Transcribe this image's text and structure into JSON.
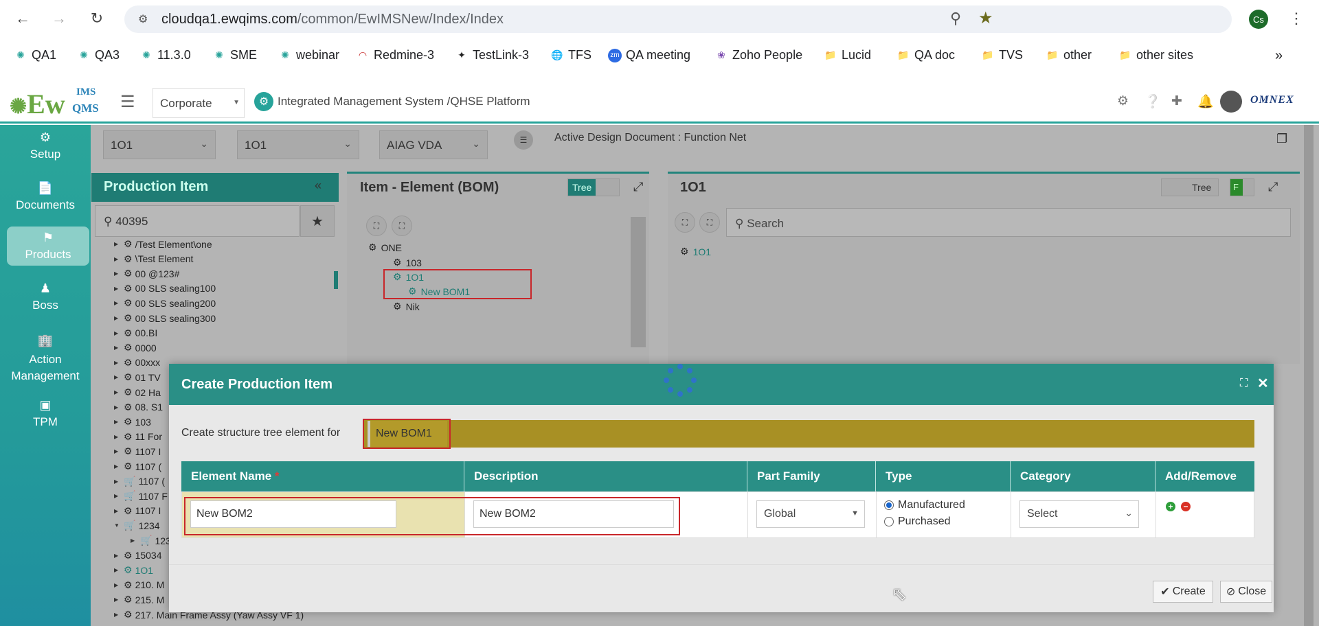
{
  "browser": {
    "url_host": "cloudqa1.ewqims.com",
    "url_path": "/common/EwIMSNew/Index/Index",
    "profile_initials": "Cs"
  },
  "bookmarks": [
    "QA1",
    "QA3",
    "11.3.0",
    "SME",
    "webinar",
    "Redmine-3",
    "TestLink-3",
    "TFS",
    "QA meeting",
    "Zoho People",
    "Lucid",
    "QA doc",
    "TVS",
    "other",
    "other sites"
  ],
  "header": {
    "logo_main": "Ew",
    "logo_ims": "IMS",
    "logo_qms": "QMS",
    "corporate_value": "Corporate",
    "platform_title": "Integrated Management System /QHSE Platform",
    "brand": "OMNEX"
  },
  "sidebar": {
    "items": [
      {
        "label": "Setup"
      },
      {
        "label": "Documents"
      },
      {
        "label": "Products"
      },
      {
        "label": "Boss"
      },
      {
        "label": "Action Management"
      },
      {
        "label": "TPM"
      }
    ]
  },
  "filters": {
    "select1": "1O1",
    "select2": "1O1",
    "select3": "AIAG VDA",
    "active_doc": "Active Design Document : Function Net"
  },
  "production_item": {
    "title": "Production Item",
    "search_value": "40395",
    "tree": [
      "/Test Element\\one",
      "\\Test Element",
      "00 @123#",
      "00 SLS sealing100",
      "00 SLS sealing200",
      "00 SLS sealing300",
      "00.BI",
      "0000",
      "00xxx",
      "01 TV",
      "02 Ha",
      "08. S1",
      "103",
      "11 For",
      "1107 I",
      "1107 (",
      "1107 (",
      "1107 F",
      "1107 I",
      "1234",
      "123",
      "15034",
      "1O1",
      "210. M",
      "215. M",
      "217. Main Frame Assy (Yaw Assy VF 1)"
    ]
  },
  "bom": {
    "title": "Item - Element (BOM)",
    "toggle_label": "Tree",
    "tree": [
      {
        "label": "ONE"
      },
      {
        "label": "103"
      },
      {
        "label": "1O1"
      },
      {
        "label": "New BOM1"
      },
      {
        "label": "Nik"
      }
    ]
  },
  "right_panel": {
    "title": "1O1",
    "toggle_label": "Tree",
    "f_label": "F",
    "search_placeholder": "Search",
    "tree_root": "1O1"
  },
  "modal": {
    "title": "Create Production Item",
    "for_label": "Create structure tree element for",
    "for_value": "New BOM1",
    "columns": [
      "Element Name",
      "Description",
      "Part Family",
      "Type",
      "Category",
      "Add/Remove"
    ],
    "required_mark": "*",
    "row": {
      "element_name": "New BOM2",
      "description": "New BOM2",
      "part_family": "Global",
      "type_options": [
        "Manufactured",
        "Purchased"
      ],
      "type_selected": "Manufactured",
      "category": "Select"
    },
    "create_label": "Create",
    "close_label": "Close"
  }
}
